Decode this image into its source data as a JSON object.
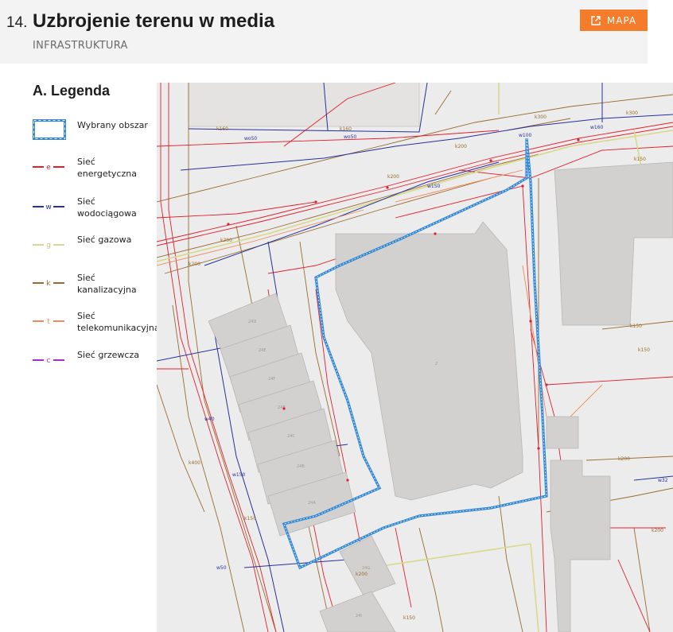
{
  "header": {
    "number": "14.",
    "title": "Uzbrojenie terenu w media",
    "subtitle": "INFRASTRUKTURA",
    "map_button_label": "MAPA"
  },
  "legend": {
    "title": "A. Legenda",
    "items": [
      {
        "label_lines": [
          "Wybrany obszar"
        ],
        "symbol": "selected-area",
        "color": "#2f86d6"
      },
      {
        "label_lines": [
          "Sieć",
          "energetyczna"
        ],
        "letter": "e",
        "color": "#e01f2d"
      },
      {
        "label_lines": [
          "Sieć",
          "wodociągowa"
        ],
        "letter": "w",
        "color": "#27309b"
      },
      {
        "label_lines": [
          "Sieć gazowa"
        ],
        "letter": "g",
        "color": "#d8d98a"
      },
      {
        "label_lines": [
          "Sieć",
          "kanalizacyjna"
        ],
        "letter": "k",
        "color": "#9a6b2f"
      },
      {
        "label_lines": [
          "Sieć",
          "telekomunikacyjna"
        ],
        "letter": "t",
        "color": "#f08a5a"
      },
      {
        "label_lines": [
          "Sieć grzewcza"
        ],
        "letter": "c",
        "color": "#a22fc9"
      }
    ]
  },
  "map": {
    "building_labels": [
      "24D",
      "24E",
      "24F",
      "24B",
      "24C",
      "24B",
      "24A",
      "24G",
      "2",
      "24I"
    ],
    "network_labels": [
      "k160",
      "wo50",
      "k160",
      "wo50",
      "k200",
      "k200",
      "w100",
      "k300",
      "w160",
      "k200",
      "k150",
      "k300",
      "k200",
      "w150",
      "k150",
      "k150",
      "w32",
      "k200",
      "w40",
      "k400",
      "k200",
      "k150",
      "w150",
      "k200",
      "k150",
      "w50"
    ],
    "colors": {
      "background": "#ececec",
      "building": "#d3d1cf",
      "building_outline": "#b9b7b5",
      "selected_area": "#2f86d6",
      "electric": "#e01f2d",
      "water": "#27309b",
      "gas": "#d8d98a",
      "sewer": "#9a6b2f",
      "telecom": "#f08a5a"
    }
  }
}
